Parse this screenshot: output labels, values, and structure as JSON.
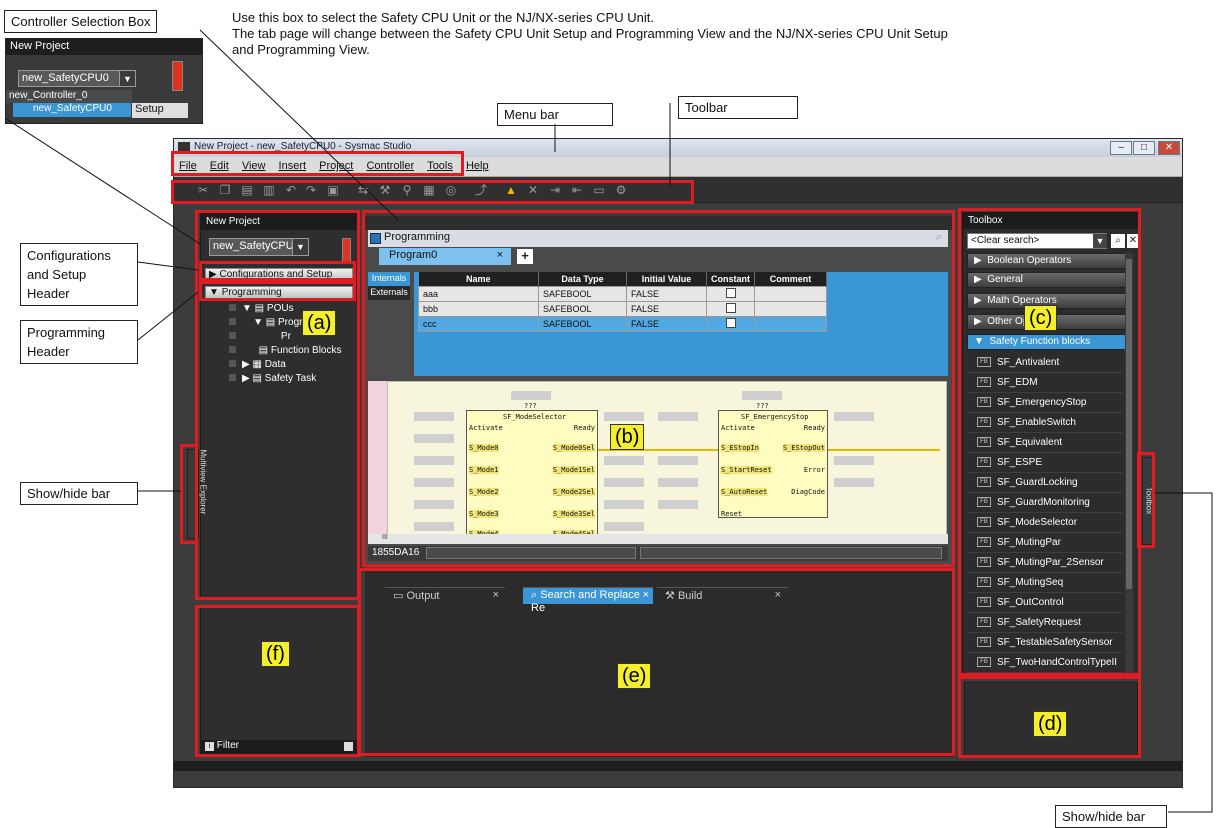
{
  "callouts": {
    "controller_selection_box": "Controller Selection Box",
    "menu_bar": "Menu bar",
    "toolbar": "Toolbar",
    "config_header": [
      "Configurations",
      "and Setup",
      "Header"
    ],
    "programming_header": [
      "Programming",
      "Header"
    ],
    "show_hide_left": "Show/hide bar",
    "show_hide_right": "Show/hide bar"
  },
  "description": [
    "Use this box to select the Safety CPU Unit or the NJ/NX-series CPU Unit.",
    "The tab page will change between the Safety CPU Unit Setup and Programming View and the NJ/NX-series CPU Unit Setup",
    "and Programming View."
  ],
  "inset": {
    "title": "New Project",
    "selected": "new_SafetyCPU0",
    "options": [
      "new_Controller_0",
      "new_SafetyCPU0"
    ],
    "setup_label": "Setup"
  },
  "window": {
    "title": "New Project - new_SafetyCPU0 - Sysmac Studio",
    "menus": [
      "File",
      "Edit",
      "View",
      "Insert",
      "Project",
      "Controller",
      "Tools",
      "Help"
    ]
  },
  "explorer": {
    "title": "New Project",
    "controller": "new_SafetyCPU0",
    "config_header": "Configurations and Setup",
    "programming_header": "Programming",
    "tree": [
      "POUs",
      "Progr",
      "Pr",
      "Function Blocks",
      "Data",
      "Safety Task"
    ],
    "vertical_label": "Multiview Explorer",
    "filter": "Filter"
  },
  "editor": {
    "title": "Programming",
    "tab": "Program0",
    "side_tabs": [
      "Internals",
      "Externals"
    ],
    "columns": [
      "Name",
      "Data Type",
      "Initial Value",
      "Constant",
      "Comment"
    ],
    "rows": [
      {
        "name": "aaa",
        "type": "SAFEBOOL",
        "init": "FALSE"
      },
      {
        "name": "bbb",
        "type": "SAFEBOOL",
        "init": "FALSE"
      },
      {
        "name": "ccc",
        "type": "SAFEBOOL",
        "init": "FALSE"
      }
    ],
    "status": "1855DA16",
    "scroll_mark": "III"
  },
  "fbd": {
    "fb1": {
      "qmark": "???",
      "name": "SF_ModeSelector",
      "inputs": [
        "Activate",
        "S_Mode0",
        "S_Mode1",
        "S_Mode2",
        "S_Mode3",
        "S_Mode4"
      ],
      "outputs": [
        "Ready",
        "S_Mode0Sel",
        "S_Mode1Sel",
        "S_Mode2Sel",
        "S_Mode3Sel",
        "S_Mode4Sel"
      ]
    },
    "fb2": {
      "qmark": "???",
      "name": "SF_EmergencyStop",
      "inputs": [
        "Activate",
        "S_EStopIn",
        "S_StartReset",
        "S_AutoReset",
        "Reset"
      ],
      "outputs": [
        "Ready",
        "S_EStopOut",
        "Error",
        "DiagCode"
      ]
    }
  },
  "output": {
    "tabs": [
      "Output",
      "Search and Replace Re",
      "Build"
    ]
  },
  "toolbox": {
    "title": "Toolbox",
    "search": "<Clear search>",
    "categories": [
      "Boolean Operators",
      "General",
      "Math Operators",
      "Other Op",
      "Safety Function blocks"
    ],
    "items": [
      "SF_Antivalent",
      "SF_EDM",
      "SF_EmergencyStop",
      "SF_EnableSwitch",
      "SF_Equivalent",
      "SF_ESPE",
      "SF_GuardLocking",
      "SF_GuardMonitoring",
      "SF_ModeSelector",
      "SF_MutingPar",
      "SF_MutingPar_2Sensor",
      "SF_MutingSeq",
      "SF_OutControl",
      "SF_SafetyRequest",
      "SF_TestableSafetySensor",
      "SF_TwoHandControlTypeII"
    ],
    "vertical_label": "Toolbox",
    "fb_icon": "FB"
  },
  "markers": {
    "a": "(a)",
    "b": "(b)",
    "c": "(c)",
    "d": "(d)",
    "e": "(e)",
    "f": "(f)"
  },
  "colors": {
    "highlight": "#e01b22",
    "marker": "#f4ef2a",
    "accent": "#3b96d6"
  }
}
